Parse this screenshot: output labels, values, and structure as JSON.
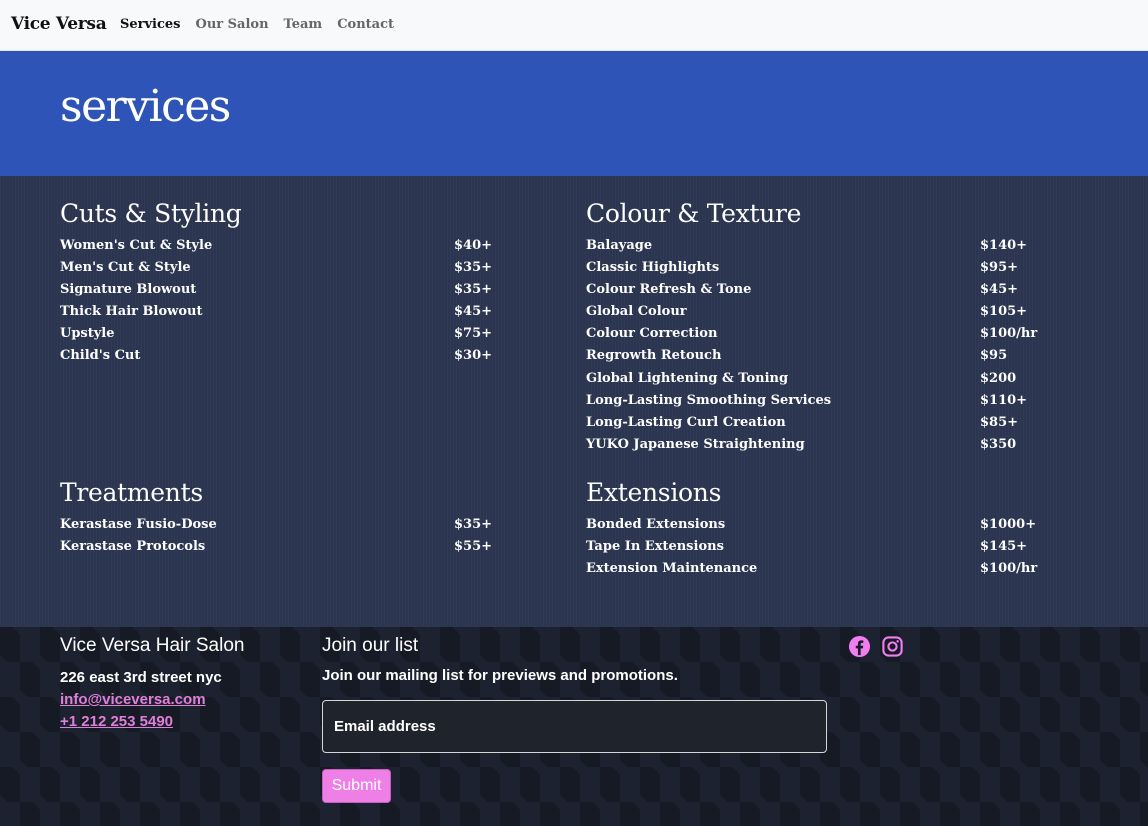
{
  "nav": {
    "brand": "Vice Versa",
    "links": [
      "Services",
      "Our Salon",
      "Team",
      "Contact"
    ]
  },
  "hero": {
    "title": "services"
  },
  "sections": {
    "cuts": {
      "title": "Cuts & Styling",
      "items": [
        {
          "name": "Women's Cut & Style",
          "price": "$40+"
        },
        {
          "name": "Men's Cut & Style",
          "price": "$35+"
        },
        {
          "name": "Signature Blowout",
          "price": "$35+"
        },
        {
          "name": "Thick Hair Blowout",
          "price": "$45+"
        },
        {
          "name": "Upstyle",
          "price": "$75+"
        },
        {
          "name": "Child's Cut",
          "price": "$30+"
        }
      ]
    },
    "colour": {
      "title": "Colour & Texture",
      "items": [
        {
          "name": "Balayage",
          "price": "$140+"
        },
        {
          "name": "Classic Highlights",
          "price": "$95+"
        },
        {
          "name": "Colour Refresh & Tone",
          "price": "$45+"
        },
        {
          "name": "Global Colour",
          "price": "$105+"
        },
        {
          "name": "Colour Correction",
          "price": "$100/hr"
        },
        {
          "name": "Regrowth Retouch",
          "price": "$95"
        },
        {
          "name": "Global Lightening & Toning",
          "price": "$200"
        },
        {
          "name": "Long-Lasting Smoothing Services",
          "price": "$110+"
        },
        {
          "name": "Long-Lasting Curl Creation",
          "price": "$85+"
        },
        {
          "name": "YUKO Japanese Straightening",
          "price": "$350"
        }
      ]
    },
    "treatments": {
      "title": "Treatments",
      "items": [
        {
          "name": "Kerastase Fusio-Dose",
          "price": "$35+"
        },
        {
          "name": "Kerastase Protocols",
          "price": "$55+"
        }
      ]
    },
    "extensions": {
      "title": "Extensions",
      "items": [
        {
          "name": "Bonded Extensions",
          "price": "$1000+"
        },
        {
          "name": "Tape In Extensions",
          "price": "$145+"
        },
        {
          "name": "Extension Maintenance",
          "price": "$100/hr"
        }
      ]
    }
  },
  "footer": {
    "salon_name": "Vice Versa Hair Salon",
    "address": "226 east 3rd street nyc",
    "email": "info@viceversa.com",
    "phone": "+1 212 253 5490",
    "join_title": "Join our list",
    "join_desc": "Join our mailing list for previews and promotions.",
    "email_placeholder": "Email address",
    "submit_label": "Submit",
    "social": [
      "facebook-icon",
      "instagram-icon"
    ]
  },
  "colors": {
    "hero_bg": "#2e54b7",
    "services_bg": "#2b3550",
    "footer_bg": "#161a24",
    "accent_pink": "#ee7fe6",
    "link_pink": "#e07fd9"
  }
}
